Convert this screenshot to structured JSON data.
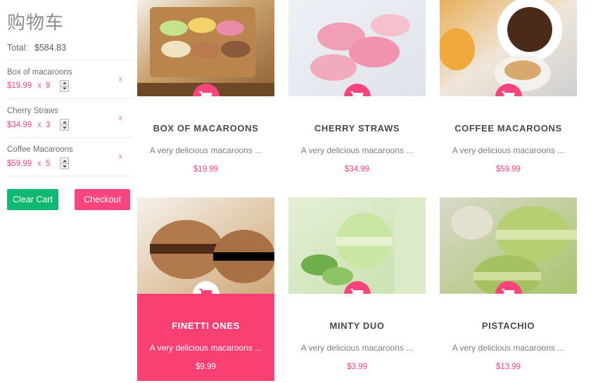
{
  "cart": {
    "title": "购物车",
    "total_label": "Total:",
    "total_amount": "$584.83",
    "items": [
      {
        "name": "Box of macaroons",
        "price": "$19.99",
        "times": "x",
        "qty": "9",
        "remove": "x"
      },
      {
        "name": "Cherry Straws",
        "price": "$34.99",
        "times": "x",
        "qty": "3",
        "remove": "x"
      },
      {
        "name": "Coffee Macaroons",
        "price": "$59.99",
        "times": "x",
        "qty": "5",
        "remove": "x"
      }
    ],
    "clear_label": "Clear Cart",
    "checkout_label": "Checkout"
  },
  "colors": {
    "accent_pink": "#f9447e",
    "clear_green": "#10b971",
    "price_pink": "#f9447e",
    "title_gray": "#4a4a4a"
  },
  "products": [
    {
      "title": "BOX OF MACAROONS",
      "desc": "A very delicious macaroons ...",
      "price": "$19.99",
      "cart_icon": "shopping-cart-icon",
      "active": false
    },
    {
      "title": "CHERRY STRAWS",
      "desc": "A very delicious macaroons ...",
      "price": "$34.99",
      "cart_icon": "shopping-cart-icon",
      "active": false
    },
    {
      "title": "COFFEE MACAROONS",
      "desc": "A very delicious macaroons ...",
      "price": "$59.99",
      "cart_icon": "shopping-cart-icon",
      "active": false
    },
    {
      "title": "FINETTI ONES",
      "desc": "A very delicious macaroons ...",
      "price": "$9.99",
      "cart_icon": "shopping-cart-icon",
      "active": true
    },
    {
      "title": "MINTY DUO",
      "desc": "A very delicious macaroons ...",
      "price": "$3.99",
      "cart_icon": "shopping-cart-icon",
      "active": false
    },
    {
      "title": "PISTACHIO",
      "desc": "A very delicious macaroons ...",
      "price": "$13.99",
      "cart_icon": "shopping-cart-icon",
      "active": false
    }
  ]
}
